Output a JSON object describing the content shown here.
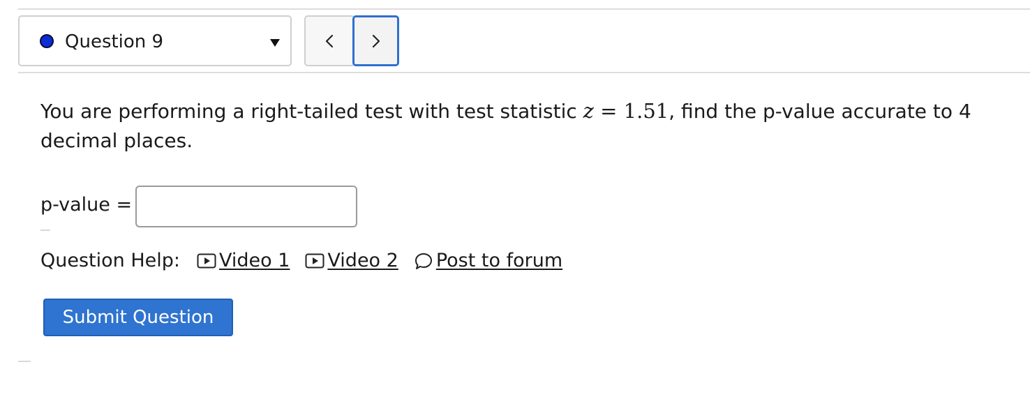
{
  "navigation": {
    "question_label": "Question 9",
    "status_color": "#0c2cd4",
    "dropdown_icon": "chevron-down-icon",
    "prev_icon": "chevron-left-icon",
    "next_icon": "chevron-right-icon"
  },
  "question": {
    "text_before": "You are performing a right-tailed test with test statistic ",
    "math_var": "z",
    "math_rest": " = 1.51",
    "text_after": ", find the p-value accurate to 4 decimal places."
  },
  "answer": {
    "label": "p-value =",
    "value": ""
  },
  "help": {
    "label": "Question Help:",
    "links": [
      {
        "label": "Video 1",
        "icon": "video-play-icon"
      },
      {
        "label": "Video 2",
        "icon": "video-play-icon"
      },
      {
        "label": "Post to forum",
        "icon": "speech-bubble-icon"
      }
    ]
  },
  "submit": {
    "label": "Submit Question",
    "color": "#2f74d0"
  }
}
